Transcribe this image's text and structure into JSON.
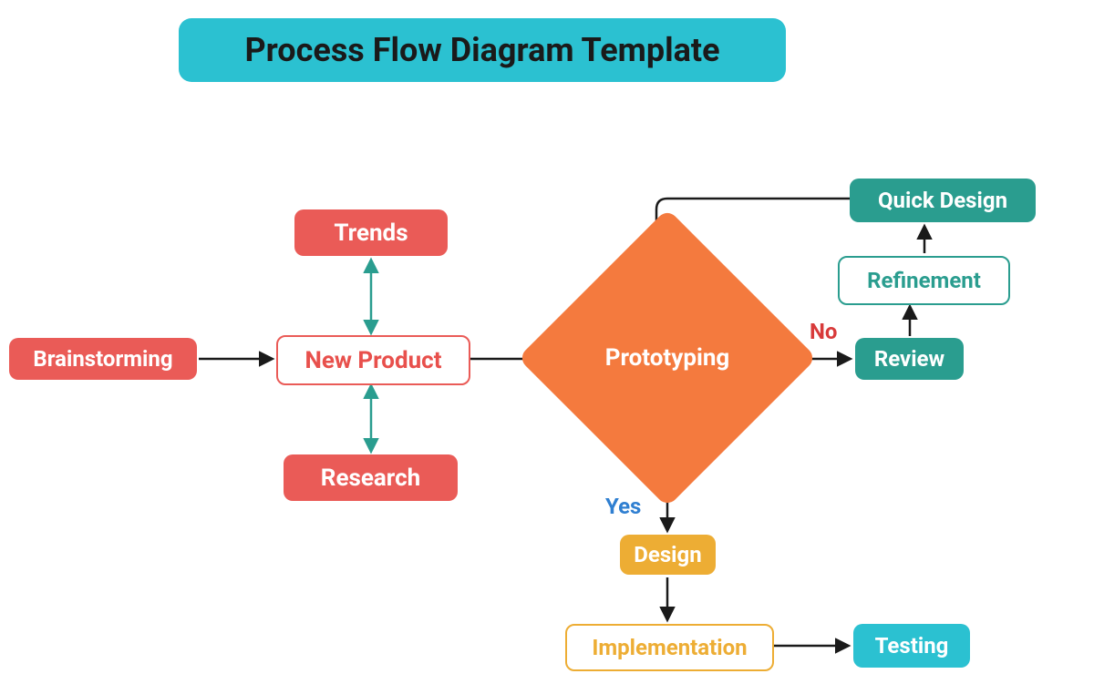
{
  "title": "Process Flow Diagram Template",
  "nodes": {
    "brainstorming": "Brainstorming",
    "new_product": "New Product",
    "trends": "Trends",
    "research": "Research",
    "prototyping": "Prototyping",
    "review": "Review",
    "refinement": "Refinement",
    "quick_design": "Quick Design",
    "design": "Design",
    "implementation": "Implementation",
    "testing": "Testing"
  },
  "edge_labels": {
    "no": "No",
    "yes": "Yes"
  },
  "colors": {
    "banner": "#2bc1d1",
    "red": "#ea5b57",
    "orange": "#f47a3e",
    "teal": "#2a9d8f",
    "amber": "#edad34",
    "cyan": "#2bc1d1"
  }
}
